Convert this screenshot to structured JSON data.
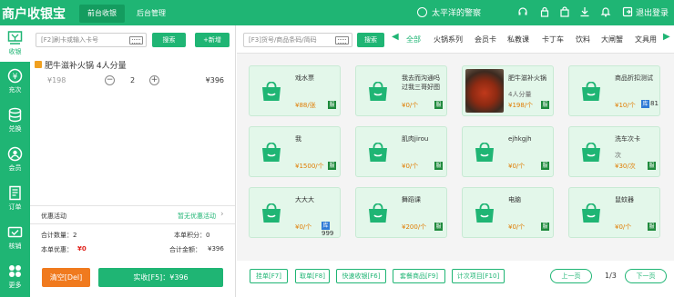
{
  "app": {
    "title": "商户收银宝"
  },
  "top_tabs": [
    {
      "label": "前台收银"
    },
    {
      "label": "后台管理"
    }
  ],
  "user": {
    "name": "太平洋的警察",
    "logout": "退出登录"
  },
  "sidebar": {
    "items": [
      {
        "label": "收银",
        "icon": "cashier-icon"
      },
      {
        "label": "充次",
        "icon": "recharge-icon"
      },
      {
        "label": "兑换",
        "icon": "exchange-icon"
      },
      {
        "label": "会员",
        "icon": "member-icon"
      },
      {
        "label": "订单",
        "icon": "order-icon"
      },
      {
        "label": "核销",
        "icon": "verify-icon"
      },
      {
        "label": "更多",
        "icon": "more-icon"
      }
    ]
  },
  "member": {
    "placeholder": "[F2]刷卡或输入卡号",
    "search_label": "搜索",
    "add_label": "+新增"
  },
  "cart": {
    "items": [
      {
        "name": "肥牛滋补火锅 4人分量",
        "original": "¥198",
        "qty": "2",
        "total": "¥396"
      }
    ]
  },
  "discount": {
    "label": "优惠活动",
    "value": "暂无优惠活动"
  },
  "summary": {
    "qty_label": "合计数量：2",
    "points_label": "本单积分：0",
    "discount_label": "本单优惠：",
    "discount_value": "¥0",
    "total_label": "合计金额：",
    "total_value": "¥396"
  },
  "actions": {
    "clear": "清空[Del]",
    "pay": "实收[F5]：¥396"
  },
  "product_search": {
    "placeholder": "[F3]货号/商品条码/简码",
    "search_label": "搜索"
  },
  "categories": [
    "全部",
    "火锅系列",
    "会员卡",
    "私教课",
    "卡丁车",
    "饮料",
    "大闸蟹",
    "文具用"
  ],
  "products": [
    {
      "name": "戏水票",
      "price": "¥88/张",
      "tag": "服"
    },
    {
      "name": "我去而沟通吗过我三哥好图",
      "price": "¥0/个",
      "tag": "服"
    },
    {
      "name": "肥牛滋补火锅",
      "unit": "4人分量",
      "price": "¥198/个",
      "tag": "服"
    },
    {
      "name": "商品折扣测试",
      "price": "¥10/个",
      "stock_tag": "库",
      "stock": "81"
    },
    {
      "name": "我",
      "price": "¥1500/个",
      "tag": "服"
    },
    {
      "name": "肌肉jirou",
      "price": "¥0/个",
      "tag": "服"
    },
    {
      "name": "ejhkgjh",
      "price": "¥0/个",
      "tag": "服"
    },
    {
      "name": "洗车次卡",
      "unit": "次",
      "price": "¥30/次",
      "tag": "服"
    },
    {
      "name": "大大大",
      "price": "¥0/个",
      "stock_tag": "库",
      "stock": "999"
    },
    {
      "name": "舞蹈课",
      "price": "¥200/个",
      "tag": "服"
    },
    {
      "name": "电脑",
      "price": "¥0/个",
      "tag": "服"
    },
    {
      "name": "鼠蚊器",
      "price": "¥0/个",
      "tag": "服"
    }
  ],
  "bottom_buttons": [
    "挂单[F7]",
    "取单[F8]",
    "快速收银[F6]",
    "套餐商品[F9]",
    "计次项目[F10]"
  ],
  "pagination": {
    "prev": "上一页",
    "page": "1/3",
    "next": "下一页"
  }
}
